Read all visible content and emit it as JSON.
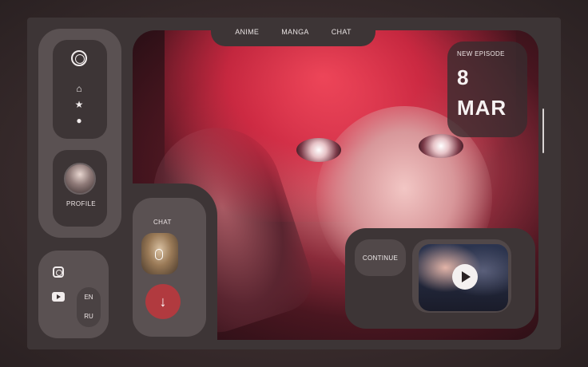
{
  "nav": {
    "items": [
      "ANIME",
      "MANGA",
      "CHAT"
    ]
  },
  "sidebar": {
    "logo_icon": "circular-knot-logo",
    "menu_icons": [
      "home-icon",
      "star-icon",
      "profile-person-icon"
    ]
  },
  "profile": {
    "label": "PROFILE"
  },
  "social": {
    "icons": [
      "instagram-icon",
      "youtube-icon"
    ]
  },
  "language": {
    "options": [
      "EN",
      "RU"
    ]
  },
  "chat": {
    "label": "CHAT",
    "down_symbol": "↓"
  },
  "episode": {
    "heading": "NEW EPISODE",
    "day": "8",
    "month": "MAR"
  },
  "continue": {
    "label": "CONTINUE"
  },
  "hero": {
    "down_symbol": "↓"
  },
  "colors": {
    "accent": "#b13a3f",
    "frame": "#3d3536",
    "panel": "#5a5152"
  }
}
